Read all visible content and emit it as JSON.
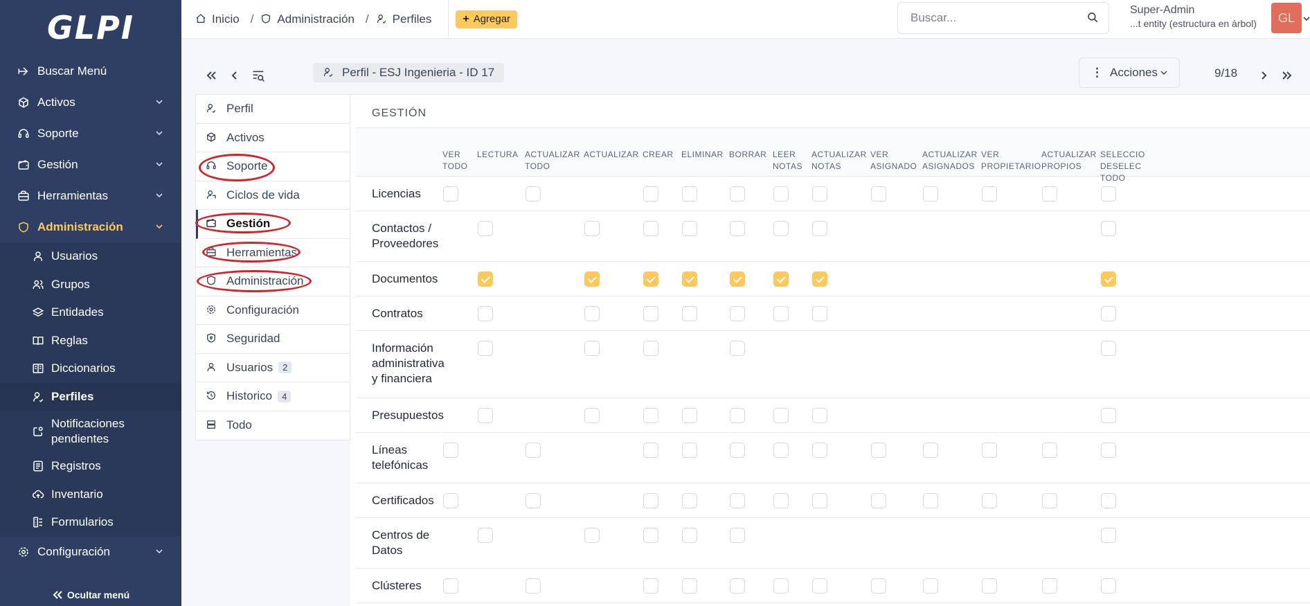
{
  "sidebar": {
    "logo": "GLPI",
    "items": [
      {
        "label": "Buscar Menú",
        "icon": "arrow-right-icon"
      },
      {
        "label": "Activos",
        "icon": "box-icon"
      },
      {
        "label": "Soporte",
        "icon": "headset-icon"
      },
      {
        "label": "Gestión",
        "icon": "wallet-icon"
      },
      {
        "label": "Herramientas",
        "icon": "briefcase-icon"
      },
      {
        "label": "Administración",
        "icon": "shield-icon"
      },
      {
        "label": "Configuración",
        "icon": "gear-icon"
      }
    ],
    "subitems": [
      {
        "label": "Usuarios",
        "icon": "user-icon"
      },
      {
        "label": "Grupos",
        "icon": "users-icon"
      },
      {
        "label": "Entidades",
        "icon": "layers-icon"
      },
      {
        "label": "Reglas",
        "icon": "book-icon"
      },
      {
        "label": "Diccionarios",
        "icon": "book-open-icon"
      },
      {
        "label": "Perfiles",
        "icon": "user-check-icon"
      },
      {
        "label": "Notificaciones pendientes",
        "icon": "notification-icon"
      },
      {
        "label": "Registros",
        "icon": "logs-icon"
      },
      {
        "label": "Inventario",
        "icon": "cloud-upload-icon"
      },
      {
        "label": "Formularios",
        "icon": "forms-icon"
      }
    ],
    "hide_label": "Ocultar menú"
  },
  "topbar": {
    "crumbs": [
      "Inicio",
      "Administración",
      "Perfiles"
    ],
    "add_label": "Agregar",
    "search_placeholder": "Buscar...",
    "user_name": "Super-Admin",
    "user_entity": "...t entity (estructura en árbol)",
    "avatar_initials": "GL"
  },
  "record": {
    "title": "Perfil -  ESJ Ingenieria - ID 17",
    "actions_label": "Acciones",
    "pager": "9/18"
  },
  "tabs": [
    {
      "label": "Perfil",
      "icon": "user-icon"
    },
    {
      "label": "Activos",
      "icon": "box-icon"
    },
    {
      "label": "Soporte",
      "icon": "headset-icon"
    },
    {
      "label": "Ciclos de vida",
      "icon": "user-cycle-icon"
    },
    {
      "label": "Gestión",
      "icon": "wallet-icon"
    },
    {
      "label": "Herramientas",
      "icon": "briefcase-icon"
    },
    {
      "label": "Administración",
      "icon": "shield-icon"
    },
    {
      "label": "Configuración",
      "icon": "gear-icon"
    },
    {
      "label": "Seguridad",
      "icon": "shield-lock-icon"
    },
    {
      "label": "Usuarios",
      "icon": "user-icon",
      "badge": "2"
    },
    {
      "label": "Historico",
      "icon": "history-icon",
      "badge": "4"
    },
    {
      "label": "Todo",
      "icon": "stack-icon"
    }
  ],
  "section": {
    "title": "GESTIÓN",
    "columns": [
      "VER\nTODO",
      "LECTURA",
      "ACTUALIZAR\nTODO",
      "ACTUALIZAR",
      "CREAR",
      "ELIMINAR",
      "BORRAR",
      "LEER\nNOTAS",
      "ACTUALIZAR\nNOTAS",
      "VER\nASIGNADO",
      "ACTUALIZAR\nASIGNADOS",
      "VER\nPROPIETARIO",
      "ACTUALIZAR\nPROPIOS",
      "SELECCIO\nDESELEC\nTODO"
    ],
    "rows": [
      {
        "label": "Licencias",
        "cells": [
          0,
          null,
          0,
          null,
          0,
          0,
          0,
          0,
          0,
          0,
          0,
          0,
          0,
          0
        ]
      },
      {
        "label": "Contactos /\nProveedores",
        "cells": [
          null,
          0,
          null,
          0,
          0,
          0,
          0,
          0,
          0,
          null,
          null,
          null,
          null,
          0
        ]
      },
      {
        "label": "Documentos",
        "cells": [
          null,
          1,
          null,
          1,
          1,
          1,
          1,
          1,
          1,
          null,
          null,
          null,
          null,
          1
        ]
      },
      {
        "label": "Contratos",
        "cells": [
          null,
          0,
          null,
          0,
          0,
          0,
          0,
          0,
          0,
          null,
          null,
          null,
          null,
          0
        ]
      },
      {
        "label": "Información\nadministrativa\ny financiera",
        "cells": [
          null,
          0,
          null,
          0,
          0,
          null,
          0,
          null,
          null,
          null,
          null,
          null,
          null,
          0
        ]
      },
      {
        "label": "Presupuestos",
        "cells": [
          null,
          0,
          null,
          0,
          0,
          0,
          0,
          0,
          0,
          null,
          null,
          null,
          null,
          0
        ]
      },
      {
        "label": "Líneas\ntelefónicas",
        "cells": [
          0,
          null,
          0,
          null,
          0,
          0,
          0,
          0,
          0,
          0,
          0,
          0,
          0,
          0
        ]
      },
      {
        "label": "Certificados",
        "cells": [
          0,
          null,
          0,
          null,
          0,
          0,
          0,
          0,
          0,
          0,
          0,
          0,
          0,
          0
        ]
      },
      {
        "label": "Centros de\nDatos",
        "cells": [
          null,
          0,
          null,
          0,
          0,
          0,
          0,
          null,
          null,
          null,
          null,
          null,
          null,
          0
        ]
      },
      {
        "label": "Clústeres",
        "cells": [
          0,
          null,
          0,
          null,
          0,
          0,
          0,
          0,
          0,
          0,
          0,
          0,
          0,
          0
        ]
      }
    ]
  },
  "colors": {
    "sidebar_bg": "#2f3f64",
    "accent": "#fec95c",
    "annotation": "#d3232b"
  }
}
